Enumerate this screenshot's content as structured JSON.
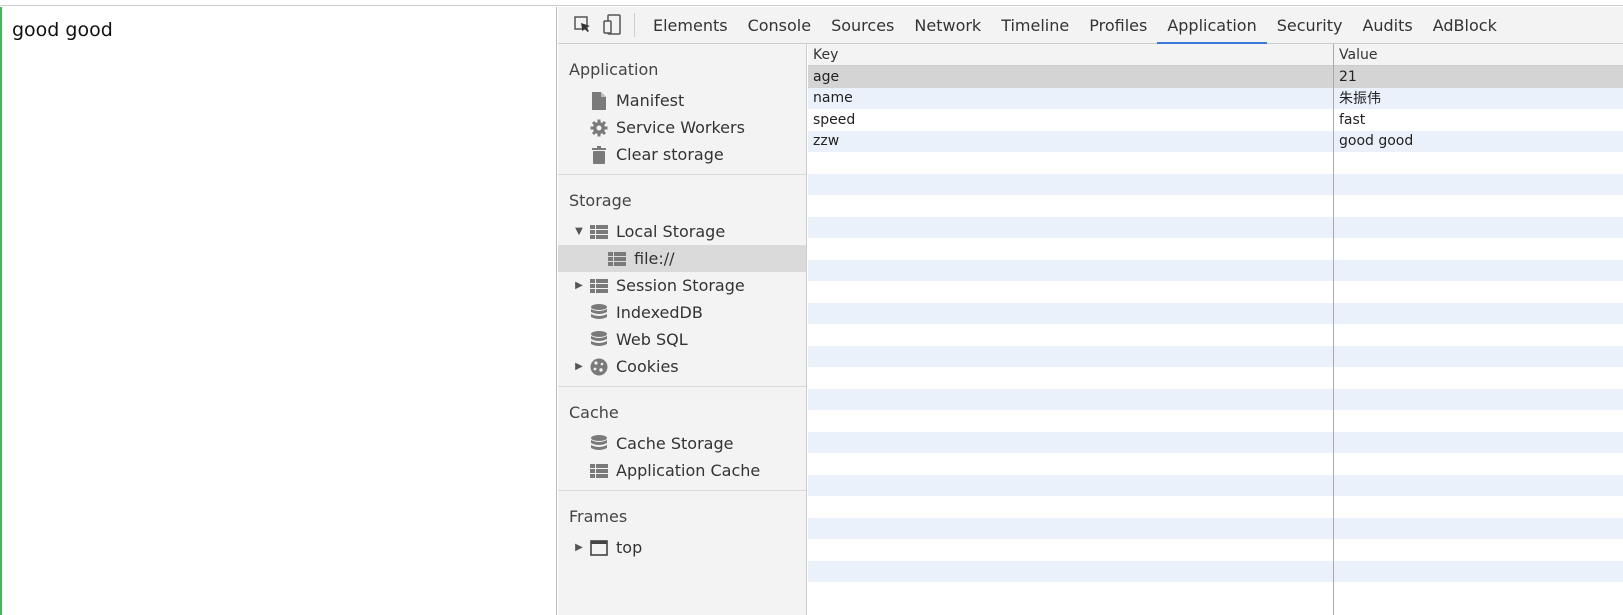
{
  "page": {
    "text": "good good"
  },
  "devtools": {
    "tabs": [
      {
        "label": "Elements",
        "active": false
      },
      {
        "label": "Console",
        "active": false
      },
      {
        "label": "Sources",
        "active": false
      },
      {
        "label": "Network",
        "active": false
      },
      {
        "label": "Timeline",
        "active": false
      },
      {
        "label": "Profiles",
        "active": false
      },
      {
        "label": "Application",
        "active": true
      },
      {
        "label": "Security",
        "active": false
      },
      {
        "label": "Audits",
        "active": false
      },
      {
        "label": "AdBlock",
        "active": false
      }
    ],
    "tool_icons": [
      "inspect-element-icon",
      "device-toolbar-icon"
    ],
    "accent_color": "#3879d9"
  },
  "sidebar": {
    "sections": [
      {
        "title": "Application",
        "items": [
          {
            "label": "Manifest",
            "icon": "document-icon"
          },
          {
            "label": "Service Workers",
            "icon": "gear-icon"
          },
          {
            "label": "Clear storage",
            "icon": "trash-icon"
          }
        ]
      },
      {
        "title": "Storage",
        "items": [
          {
            "label": "Local Storage",
            "icon": "grid-table-icon",
            "expander": "expanded"
          },
          {
            "label": "file://",
            "icon": "grid-table-icon",
            "child": true,
            "selected": true
          },
          {
            "label": "Session Storage",
            "icon": "grid-table-icon",
            "expander": "collapsed"
          },
          {
            "label": "IndexedDB",
            "icon": "database-icon"
          },
          {
            "label": "Web SQL",
            "icon": "database-icon"
          },
          {
            "label": "Cookies",
            "icon": "cookie-icon",
            "expander": "collapsed"
          }
        ]
      },
      {
        "title": "Cache",
        "items": [
          {
            "label": "Cache Storage",
            "icon": "database-icon"
          },
          {
            "label": "Application Cache",
            "icon": "grid-table-icon"
          }
        ]
      },
      {
        "title": "Frames",
        "items": [
          {
            "label": "top",
            "icon": "frame-window-icon",
            "expander": "collapsed"
          }
        ]
      }
    ]
  },
  "storage_table": {
    "columns": [
      "Key",
      "Value"
    ],
    "rows": [
      {
        "key": "age",
        "value": "21",
        "selected": true
      },
      {
        "key": "name",
        "value": "朱振伟"
      },
      {
        "key": "speed",
        "value": "fast"
      },
      {
        "key": "zzw",
        "value": "good good"
      }
    ],
    "empty_rows": 21
  }
}
